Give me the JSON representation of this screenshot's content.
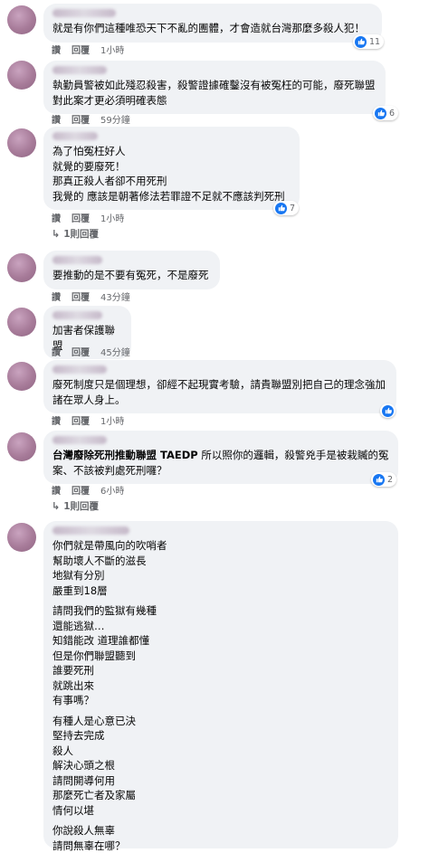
{
  "actions": {
    "like": "讚",
    "reply": "回覆"
  },
  "comments": [
    {
      "text": "就是有你們這種唯恐天下不亂的團體，才會造就台灣那麼多殺人犯！",
      "time": "1小時",
      "likes": "11"
    },
    {
      "text": "執勤員警被如此殘忍殺害，殺警證據確鑿沒有被冤枉的可能，廢死聯盟對此案才更必須明確表態",
      "time": "59分鐘",
      "likes": "6"
    },
    {
      "text": "為了怕冤枉好人\n就覺的要廢死！\n那真正殺人者卻不用死刑\n我覺的 應該是朝著修法若罪證不足就不應該判死刑",
      "time": "1小時",
      "likes": "7",
      "replies": "1則回覆"
    },
    {
      "text": "要推動的是不要有冤死，不是廢死",
      "time": "43分鐘"
    },
    {
      "text": "加害者保護聯盟",
      "time": "45分鐘"
    },
    {
      "text": "廢死制度只是個理想，卻經不起現實考驗，請貴聯盟別把自己的理念強加諸在眾人身上。",
      "time": "1小時"
    },
    {
      "author": "台灣廢除死刑推動聯盟 TAEDP",
      "text": "所以照你的邏輯，殺警兇手是被栽贓的冤案、不該被判處死刑囉？",
      "time": "6小時",
      "likes": "2",
      "replies": "1則回覆"
    },
    {
      "paragraphs": [
        "你們就是帶風向的吹哨者\n幫助壞人不斷的滋長\n地獄有分別\n嚴重到18層",
        "請問我們的監獄有幾種\n還能逃獄…\n知錯能改 道理誰都懂\n但是你們聯盟聽到\n誰要死刑\n就跳出來\n有事嗎？",
        "有種人是心意已決\n堅持去完成\n殺人\n解決心頭之根\n請問開導何用\n那麼死亡者及家屬\n情何以堪",
        "你說殺人無辜\n請問無辜在哪？"
      ]
    }
  ]
}
